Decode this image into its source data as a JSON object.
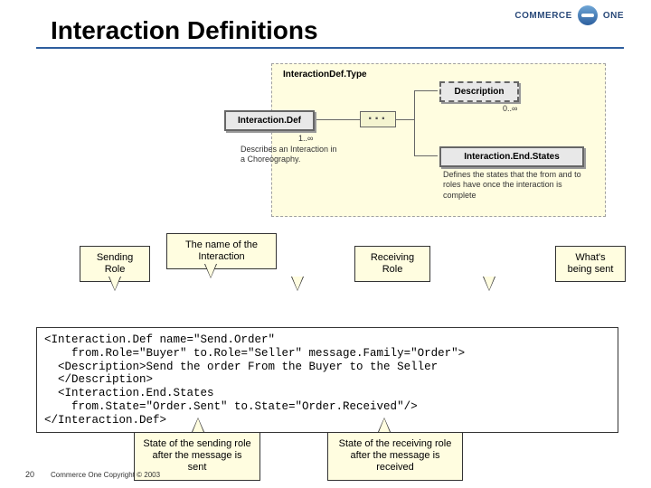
{
  "brand": {
    "name": "COMMERCE",
    "one": "ONE"
  },
  "title": "Interaction Definitions",
  "schema": {
    "panel_label": "InteractionDef.Type",
    "root": "Interaction.Def",
    "root_mult": "1..∞",
    "root_caption": "Describes an Interaction in a Choreography.",
    "desc_box": "Description",
    "desc_mult": "0..∞",
    "endstates_box": "Interaction.End.States",
    "endstates_caption": "Defines the states that the from and to roles have once the interaction is complete"
  },
  "callouts": {
    "sending_role": "Sending\nRole",
    "name": "The name of the\nInteraction",
    "receiving_role": "Receiving\nRole",
    "whats_sent": "What's\nbeing sent",
    "state_send": "State of the sending\nrole after the\nmessage is sent",
    "state_recv": "State of the receiving\nrole after the\nmessage is received"
  },
  "code": "<Interaction.Def name=\"Send.Order\"\n    from.Role=\"Buyer\" to.Role=\"Seller\" message.Family=\"Order\">\n  <Description>Send the order From the Buyer to the Seller\n  </Description>\n  <Interaction.End.States\n    from.State=\"Order.Sent\" to.State=\"Order.Received\"/>\n</Interaction.Def>",
  "footer": {
    "page": "20",
    "copyright": "Commerce One Copyright © 2003"
  }
}
